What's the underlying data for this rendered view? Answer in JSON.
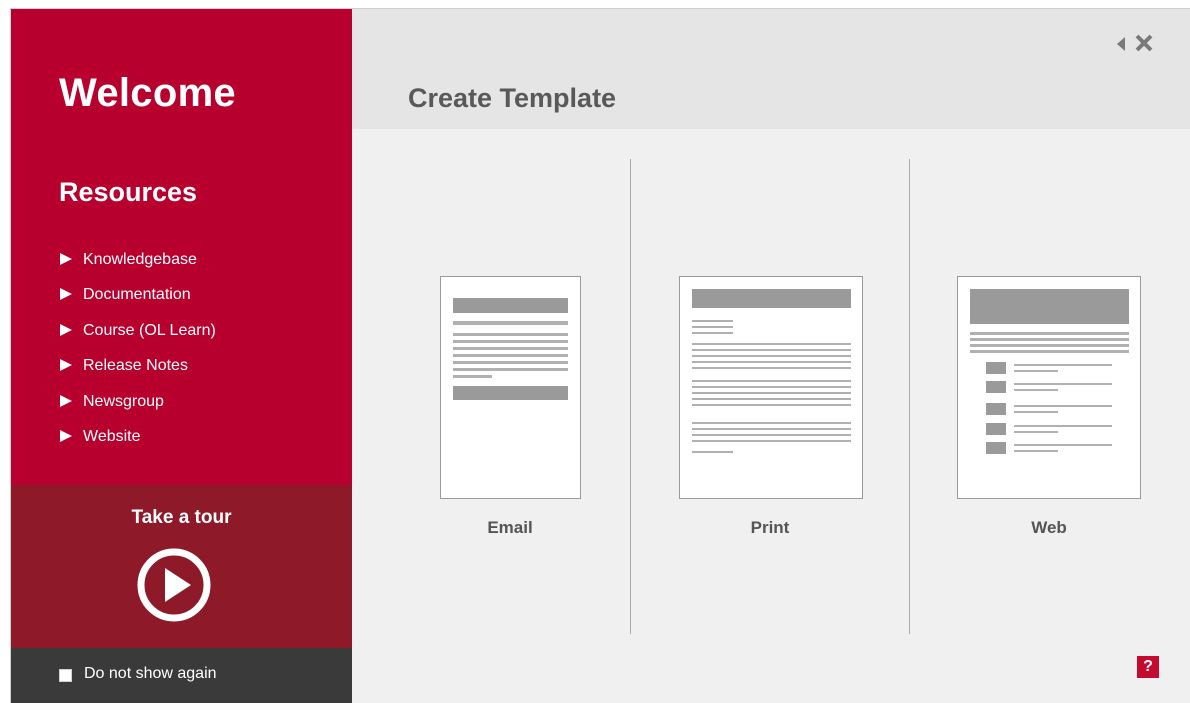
{
  "sidebar": {
    "welcome": "Welcome",
    "resources_title": "Resources",
    "links": [
      {
        "label": "Knowledgebase"
      },
      {
        "label": "Documentation"
      },
      {
        "label": "Course (OL Learn)"
      },
      {
        "label": "Release Notes"
      },
      {
        "label": "Newsgroup"
      },
      {
        "label": "Website"
      }
    ],
    "tour_title": "Take a tour",
    "do_not_show": "Do not show again"
  },
  "header": {
    "title": "Create Template"
  },
  "templates": [
    {
      "label": "Email"
    },
    {
      "label": "Print"
    },
    {
      "label": "Web"
    }
  ],
  "help_label": "?",
  "icons": {
    "back": "back-arrow-icon",
    "close": "close-icon",
    "play": "play-circle-icon",
    "help": "help-icon"
  },
  "colors": {
    "sidebar": "#b7002e",
    "tour": "#8e1a29",
    "footer": "#3a3a3a",
    "header": "#e5e5e5",
    "content": "#f0f0f0",
    "help": "#c40a2e"
  }
}
